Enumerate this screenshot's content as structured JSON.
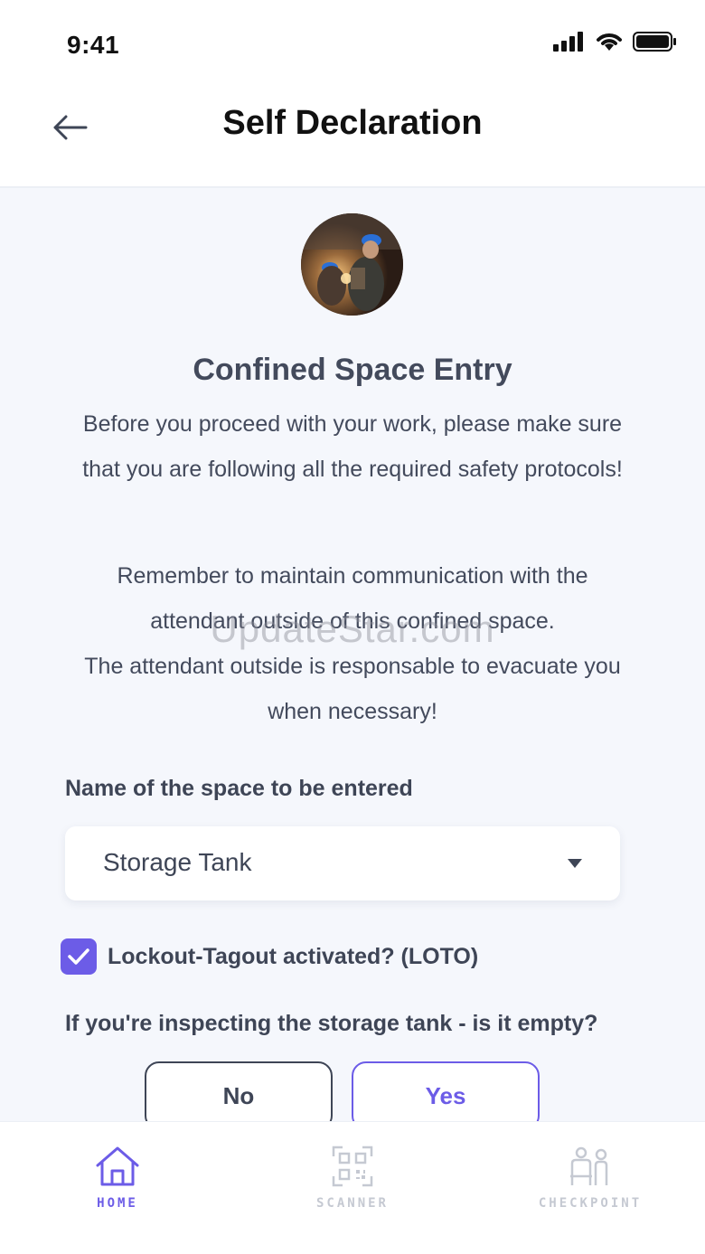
{
  "status_bar": {
    "time": "9:41"
  },
  "header": {
    "title": "Self Declaration"
  },
  "content": {
    "title": "Confined Space Entry",
    "intro": "Before you proceed with your work, please make sure that you are following all the required safety protocols!",
    "remember_1": "Remember to maintain communication with the attendant outside of this confined space.",
    "remember_2": "The attendant outside is responsable to evacuate you when necessary!",
    "watermark": "UpdateStar.com"
  },
  "form": {
    "space_label": "Name of the space to be entered",
    "space_value": "Storage Tank",
    "loto_label": "Lockout-Tagout activated? (LOTO)",
    "loto_checked": true,
    "question": "If you're inspecting the storage tank - is it empty?",
    "no_label": "No",
    "yes_label": "Yes"
  },
  "tabs": [
    {
      "label": "HOME",
      "icon": "home-icon",
      "active": true
    },
    {
      "label": "SCANNER",
      "icon": "qr-code-icon",
      "active": false
    },
    {
      "label": "CHECKPOINT",
      "icon": "people-icon",
      "active": false
    }
  ],
  "colors": {
    "accent": "#6c5ce7",
    "text": "#3e4556",
    "background": "#f5f7fc",
    "inactive": "#c5c9d2"
  }
}
